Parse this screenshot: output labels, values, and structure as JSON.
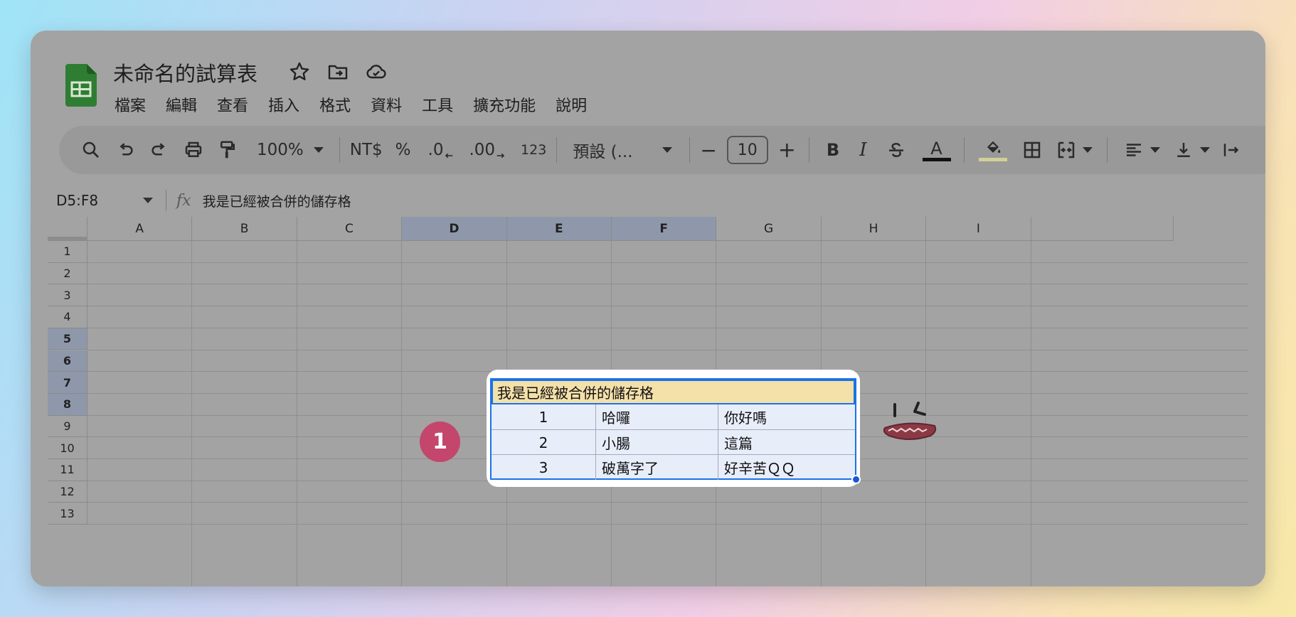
{
  "doc": {
    "title": "未命名的試算表"
  },
  "menu": [
    "檔案",
    "編輯",
    "查看",
    "插入",
    "格式",
    "資料",
    "工具",
    "擴充功能",
    "說明"
  ],
  "toolbar": {
    "zoom": "100%",
    "currency": "NT$",
    "percent": "%",
    "dec_decrease": ".0",
    "dec_increase": ".00",
    "more_formats": "123",
    "font": "預設 (...",
    "minus": "−",
    "font_size": "10",
    "plus": "+",
    "bold": "B",
    "italic": "I",
    "text_color": "A"
  },
  "formula": {
    "range": "D5:F8",
    "content": "我是已經被合併的儲存格"
  },
  "columns": [
    "A",
    "B",
    "C",
    "D",
    "E",
    "F",
    "G",
    "H",
    "I"
  ],
  "rows": [
    "1",
    "2",
    "3",
    "4",
    "5",
    "6",
    "7",
    "8",
    "9",
    "10",
    "11",
    "12",
    "13"
  ],
  "merged_cell": "我是已經被合併的儲存格",
  "table": [
    [
      "1",
      "哈囉",
      "你好嗎"
    ],
    [
      "2",
      "小腸",
      "這篇"
    ],
    [
      "3",
      "破萬字了",
      "好辛苦ＱＱ"
    ]
  ],
  "annotation": {
    "step": "1"
  },
  "colors": {
    "accent": "#1a73e8",
    "merged_fill": "#f4e0a9",
    "badge": "#c4466d"
  }
}
